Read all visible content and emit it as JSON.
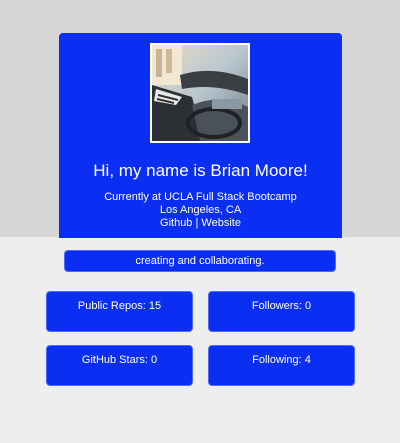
{
  "profile": {
    "greeting": "Hi, my name is Brian Moore!",
    "current": "Currently at UCLA Full Stack Bootcamp",
    "location": "Los Angeles, CA",
    "links": {
      "github": "Github",
      "separator": "|",
      "website": "Website"
    },
    "avatar_icon": "profile-photo"
  },
  "tagline": "creating and collaborating.",
  "stats": {
    "repos_label": "Public Repos: 15",
    "followers_label": "Followers: 0",
    "stars_label": "GitHub Stars: 0",
    "following_label": "Following: 4"
  },
  "colors": {
    "card_blue": "#0a2ff2",
    "top_background": "#d6d6d6",
    "page_background": "#eeeeee",
    "text": "#ffffff"
  }
}
